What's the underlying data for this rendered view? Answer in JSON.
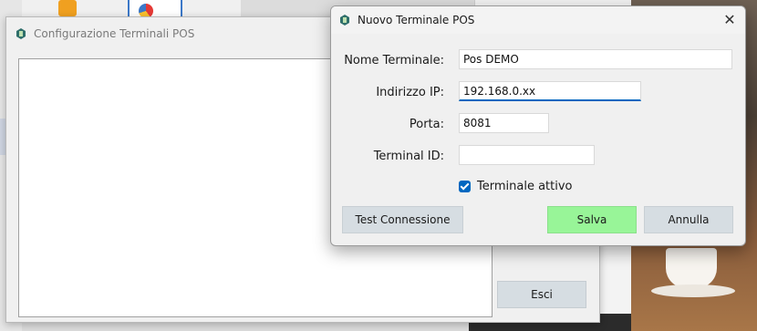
{
  "main_window": {
    "title": "Configurazione Terminali POS",
    "buttons": {
      "exit_label": "Esci"
    }
  },
  "dialog": {
    "title": "Nuovo Terminale POS",
    "fields": {
      "name_label": "Nome Terminale:",
      "name_value": "Pos DEMO",
      "ip_label": "Indirizzo IP:",
      "ip_value": "192.168.0.xx",
      "port_label": "Porta:",
      "port_value": "8081",
      "terminal_id_label": "Terminal ID:",
      "terminal_id_value": ""
    },
    "checkbox": {
      "label": "Terminale attivo",
      "checked": true
    },
    "buttons": {
      "test_label": "Test Connessione",
      "save_label": "Salva",
      "cancel_label": "Annulla"
    }
  },
  "colors": {
    "accent": "#0067c0",
    "save_button": "#98f598",
    "neutral_button": "#d6dde2"
  },
  "icons": [
    "app-icon",
    "close-icon",
    "checkmark-icon"
  ]
}
